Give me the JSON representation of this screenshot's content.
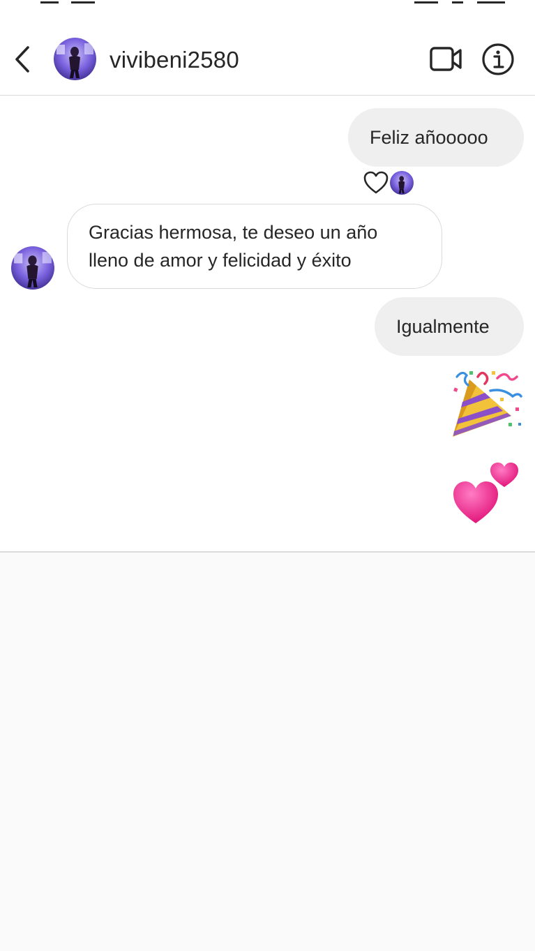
{
  "header": {
    "username": "vivibeni2580",
    "icons": {
      "back": "chevron-left-icon",
      "video": "video-camera-icon",
      "info": "info-icon"
    }
  },
  "messages": [
    {
      "side": "sent",
      "text": "Feliz añooooo",
      "reaction": "heart-icon"
    },
    {
      "side": "received",
      "lines": [
        "Gracias hermosa, te deseo un año",
        "lleno de amor y felicidad y éxito"
      ]
    },
    {
      "side": "sent",
      "text": "Igualmente"
    },
    {
      "side": "sent",
      "emoji": "party-popper-icon"
    },
    {
      "side": "sent",
      "emoji": "two-hearts-icon"
    }
  ],
  "colors": {
    "sent_bubble": "#efefef",
    "received_border": "#dbdbdb",
    "heart_emoji": "#f2308f",
    "avatar_tint": "#6a4fd6"
  }
}
